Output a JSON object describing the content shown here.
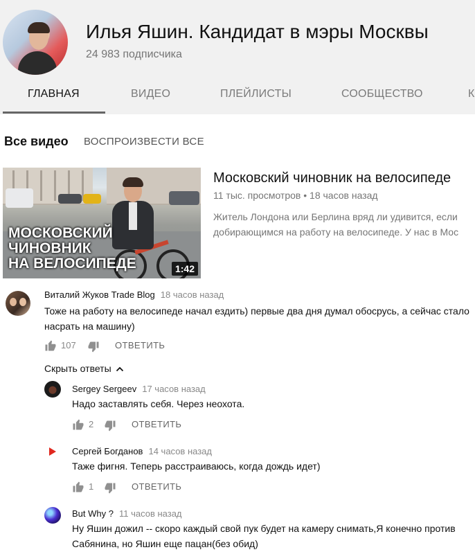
{
  "channel": {
    "title": "Илья Яшин. Кандидат в мэры Москвы",
    "subscribers": "24 983 подписчика",
    "tabs": [
      "ГЛАВНАЯ",
      "ВИДЕО",
      "ПЛЕЙЛИСТЫ",
      "СООБЩЕСТВО",
      "К"
    ],
    "active_tab": "ГЛАВНАЯ"
  },
  "section": {
    "title": "Все видео",
    "play_all": "ВОСПРОИЗВЕСТИ ВСЕ"
  },
  "video": {
    "title": "Московский чиновник на велосипеде",
    "meta": "11 тыс. просмотров • 18 часов назад",
    "description_lines": [
      "Житель Лондона или Берлина вряд ли удивится, если",
      "добирающимся на работу на велосипеде. У нас в Мос"
    ],
    "thumbnail_text": [
      "МОСКОВСКИЙ",
      "ЧИНОВНИК",
      "НА ВЕЛОСИПЕДЕ"
    ],
    "duration": "1:42"
  },
  "comments": {
    "main": {
      "author": "Виталий Жуков Trade Blog",
      "time": "18 часов назад",
      "text_lines": [
        "Тоже на работу на велосипеде начал ездить) первые два дня думал обосрусь, а сейчас стало",
        "насрать на машину)"
      ],
      "likes": "107",
      "reply_label": "ОТВЕТИТЬ"
    },
    "hide_replies_label": "Скрыть ответы",
    "replies": [
      {
        "author": "Sergey Sergeev",
        "time": "17 часов назад",
        "text_lines": [
          "Надо заставлять себя. Через неохота."
        ],
        "likes": "2",
        "reply_label": "ОТВЕТИТЬ"
      },
      {
        "author": "Сергей Богданов",
        "time": "14 часов назад",
        "text_lines": [
          "Таже фигня. Теперь расстраиваюсь, когда дождь идет)"
        ],
        "likes": "1",
        "reply_label": "ОТВЕТИТЬ"
      },
      {
        "author": "But Why ?",
        "time": "11 часов назад",
        "text_lines": [
          "Ну Яшин дожил -- скоро каждый свой пук будет на камеру снимать,Я конечно против",
          "Сабянина, но Яшин еще пацан(без обид)"
        ]
      }
    ]
  },
  "colors": {
    "header_bg": "#f1f1f1",
    "text_primary": "#111111",
    "text_secondary": "#757575",
    "duration_badge": "#000000",
    "reply_red_avatar": "#e0281f"
  },
  "icons": [
    "thumbs-up-icon",
    "thumbs-down-icon",
    "chevron-up-icon"
  ]
}
